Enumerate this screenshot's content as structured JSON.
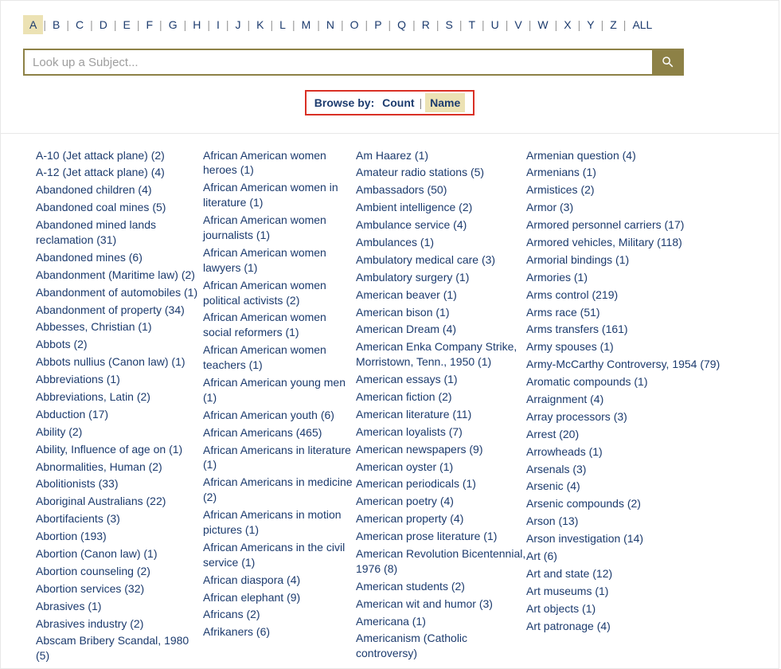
{
  "alpha": {
    "letters": [
      "A",
      "B",
      "C",
      "D",
      "E",
      "F",
      "G",
      "H",
      "I",
      "J",
      "K",
      "L",
      "M",
      "N",
      "O",
      "P",
      "Q",
      "R",
      "S",
      "T",
      "U",
      "V",
      "W",
      "X",
      "Y",
      "Z",
      "ALL"
    ],
    "active": "A"
  },
  "search": {
    "placeholder": "Look up a Subject..."
  },
  "browse": {
    "label": "Browse by:",
    "count": "Count",
    "name": "Name",
    "active": "Name"
  },
  "columns": [
    [
      "A-10 (Jet attack plane) (2)",
      "A-12 (Jet attack plane) (4)",
      "Abandoned children (4)",
      "Abandoned coal mines (5)",
      "Abandoned mined lands reclamation (31)",
      "Abandoned mines (6)",
      "Abandonment (Maritime law) (2)",
      "Abandonment of automobiles (1)",
      "Abandonment of property (34)",
      "Abbesses, Christian (1)",
      "Abbots (2)",
      "Abbots nullius (Canon law) (1)",
      "Abbreviations (1)",
      "Abbreviations, Latin (2)",
      "Abduction (17)",
      "Ability (2)",
      "Ability, Influence of age on (1)",
      "Abnormalities, Human (2)",
      "Abolitionists (33)",
      "Aboriginal Australians (22)",
      "Abortifacients (3)",
      "Abortion (193)",
      "Abortion (Canon law) (1)",
      "Abortion counseling (2)",
      "Abortion services (32)",
      "Abrasives (1)",
      "Abrasives industry (2)",
      "Abscam Bribery Scandal, 1980 (5)"
    ],
    [
      "African American women heroes (1)",
      "African American women in literature (1)",
      "African American women journalists (1)",
      "African American women lawyers (1)",
      "African American women political activists (2)",
      "African American women social reformers (1)",
      "African American women teachers (1)",
      "African American young men (1)",
      "African American youth (6)",
      "African Americans (465)",
      "African Americans in literature (1)",
      "African Americans in medicine (2)",
      "African Americans in motion pictures (1)",
      "African Americans in the civil service (1)",
      "African diaspora (4)",
      "African elephant (9)",
      "Africans (2)",
      "Afrikaners (6)"
    ],
    [
      "Am Haarez (1)",
      "Amateur radio stations (5)",
      "Ambassadors (50)",
      "Ambient intelligence (2)",
      "Ambulance service (4)",
      "Ambulances (1)",
      "Ambulatory medical care (3)",
      "Ambulatory surgery (1)",
      "American beaver (1)",
      "American bison (1)",
      "American Dream (4)",
      "American Enka Company Strike, Morristown, Tenn., 1950 (1)",
      "American essays (1)",
      "American fiction (2)",
      "American literature (11)",
      "American loyalists (7)",
      "American newspapers (9)",
      "American oyster (1)",
      "American periodicals (1)",
      "American poetry (4)",
      "American property (4)",
      "American prose literature (1)",
      "American Revolution Bicentennial, 1976 (8)",
      "American students (2)",
      "American wit and humor (3)",
      "Americana (1)",
      "Americanism (Catholic controversy)"
    ],
    [
      "Armenian question (4)",
      "Armenians (1)",
      "Armistices (2)",
      "Armor (3)",
      "Armored personnel carriers (17)",
      "Armored vehicles, Military (118)",
      "Armorial bindings (1)",
      "Armories (1)",
      "Arms control (219)",
      "Arms race (51)",
      "Arms transfers (161)",
      "Army spouses (1)",
      "Army-McCarthy Controversy, 1954 (79)",
      "Aromatic compounds (1)",
      "Arraignment (4)",
      "Array processors (3)",
      "Arrest (20)",
      "Arrowheads (1)",
      "Arsenals (3)",
      "Arsenic (4)",
      "Arsenic compounds (2)",
      "Arson (13)",
      "Arson investigation (14)",
      "Art (6)",
      "Art and state (12)",
      "Art museums (1)",
      "Art objects (1)",
      "Art patronage (4)"
    ]
  ]
}
